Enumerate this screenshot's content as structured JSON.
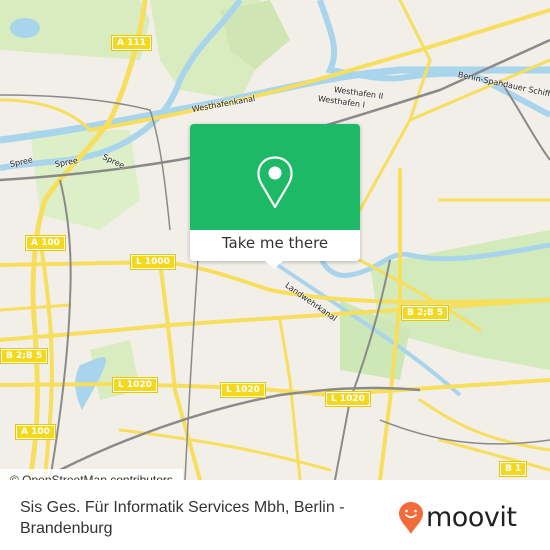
{
  "map": {
    "attribution": "© OpenStreetMap contributors",
    "road_shields": [
      {
        "label": "A 111",
        "id": "a111"
      },
      {
        "label": "A 100",
        "id": "a100-north"
      },
      {
        "label": "L 1000",
        "id": "l1000"
      },
      {
        "label": "B 2;B 5",
        "id": "b2b5-west"
      },
      {
        "label": "B 2;B 5",
        "id": "b2b5-east"
      },
      {
        "label": "L 1020",
        "id": "l1020-west"
      },
      {
        "label": "L 1020",
        "id": "l1020-center"
      },
      {
        "label": "L 1020",
        "id": "l1020-east"
      },
      {
        "label": "A 100",
        "id": "a100-south"
      },
      {
        "label": "B 1",
        "id": "b1"
      }
    ],
    "place_labels": [
      {
        "label": "Westhafenkanal"
      },
      {
        "label": "Spree"
      },
      {
        "label": "Spree"
      },
      {
        "label": "Spree"
      },
      {
        "label": "Westhafen II"
      },
      {
        "label": "Westhafen I"
      },
      {
        "label": "Berlin-Spandauer Schifffahrtskanal"
      },
      {
        "label": "Landwehrkanal"
      }
    ],
    "colors": {
      "background": "#f2efe9",
      "park": "#d8ecc0",
      "water": "#a8d4ec",
      "road": "#f7de5c",
      "rail": "#8a8a8a"
    }
  },
  "popup": {
    "icon": "map-pin-icon",
    "button_label": "Take me there",
    "color": "#1db967"
  },
  "footer": {
    "title": "Sis Ges. Für Informatik Services Mbh, Berlin - Brandenburg",
    "brand": {
      "name": "moovit",
      "icon": "moovit-pin-icon",
      "color": "#f26b3a"
    }
  }
}
